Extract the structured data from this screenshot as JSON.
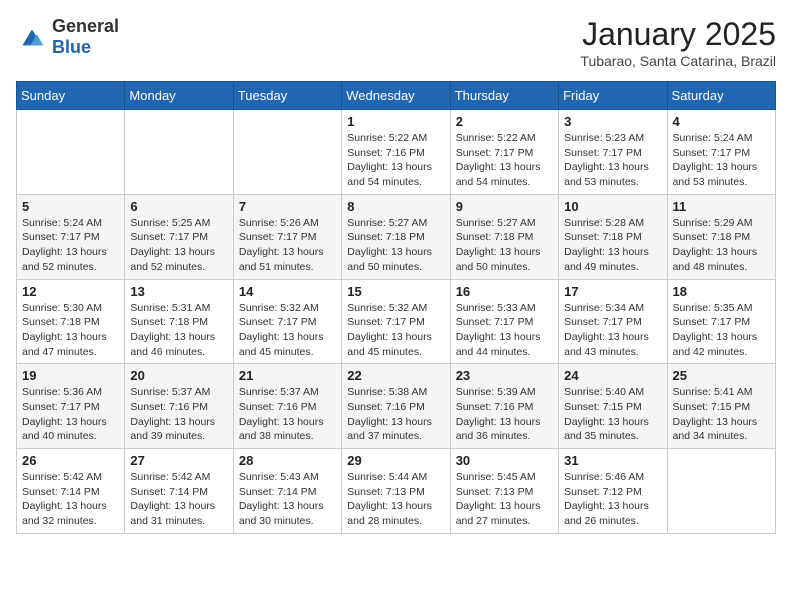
{
  "logo": {
    "general": "General",
    "blue": "Blue"
  },
  "header": {
    "month": "January 2025",
    "location": "Tubarao, Santa Catarina, Brazil"
  },
  "weekdays": [
    "Sunday",
    "Monday",
    "Tuesday",
    "Wednesday",
    "Thursday",
    "Friday",
    "Saturday"
  ],
  "weeks": [
    [
      {
        "day": "",
        "info": ""
      },
      {
        "day": "",
        "info": ""
      },
      {
        "day": "",
        "info": ""
      },
      {
        "day": "1",
        "info": "Sunrise: 5:22 AM\nSunset: 7:16 PM\nDaylight: 13 hours\nand 54 minutes."
      },
      {
        "day": "2",
        "info": "Sunrise: 5:22 AM\nSunset: 7:17 PM\nDaylight: 13 hours\nand 54 minutes."
      },
      {
        "day": "3",
        "info": "Sunrise: 5:23 AM\nSunset: 7:17 PM\nDaylight: 13 hours\nand 53 minutes."
      },
      {
        "day": "4",
        "info": "Sunrise: 5:24 AM\nSunset: 7:17 PM\nDaylight: 13 hours\nand 53 minutes."
      }
    ],
    [
      {
        "day": "5",
        "info": "Sunrise: 5:24 AM\nSunset: 7:17 PM\nDaylight: 13 hours\nand 52 minutes."
      },
      {
        "day": "6",
        "info": "Sunrise: 5:25 AM\nSunset: 7:17 PM\nDaylight: 13 hours\nand 52 minutes."
      },
      {
        "day": "7",
        "info": "Sunrise: 5:26 AM\nSunset: 7:17 PM\nDaylight: 13 hours\nand 51 minutes."
      },
      {
        "day": "8",
        "info": "Sunrise: 5:27 AM\nSunset: 7:18 PM\nDaylight: 13 hours\nand 50 minutes."
      },
      {
        "day": "9",
        "info": "Sunrise: 5:27 AM\nSunset: 7:18 PM\nDaylight: 13 hours\nand 50 minutes."
      },
      {
        "day": "10",
        "info": "Sunrise: 5:28 AM\nSunset: 7:18 PM\nDaylight: 13 hours\nand 49 minutes."
      },
      {
        "day": "11",
        "info": "Sunrise: 5:29 AM\nSunset: 7:18 PM\nDaylight: 13 hours\nand 48 minutes."
      }
    ],
    [
      {
        "day": "12",
        "info": "Sunrise: 5:30 AM\nSunset: 7:18 PM\nDaylight: 13 hours\nand 47 minutes."
      },
      {
        "day": "13",
        "info": "Sunrise: 5:31 AM\nSunset: 7:18 PM\nDaylight: 13 hours\nand 46 minutes."
      },
      {
        "day": "14",
        "info": "Sunrise: 5:32 AM\nSunset: 7:17 PM\nDaylight: 13 hours\nand 45 minutes."
      },
      {
        "day": "15",
        "info": "Sunrise: 5:32 AM\nSunset: 7:17 PM\nDaylight: 13 hours\nand 45 minutes."
      },
      {
        "day": "16",
        "info": "Sunrise: 5:33 AM\nSunset: 7:17 PM\nDaylight: 13 hours\nand 44 minutes."
      },
      {
        "day": "17",
        "info": "Sunrise: 5:34 AM\nSunset: 7:17 PM\nDaylight: 13 hours\nand 43 minutes."
      },
      {
        "day": "18",
        "info": "Sunrise: 5:35 AM\nSunset: 7:17 PM\nDaylight: 13 hours\nand 42 minutes."
      }
    ],
    [
      {
        "day": "19",
        "info": "Sunrise: 5:36 AM\nSunset: 7:17 PM\nDaylight: 13 hours\nand 40 minutes."
      },
      {
        "day": "20",
        "info": "Sunrise: 5:37 AM\nSunset: 7:16 PM\nDaylight: 13 hours\nand 39 minutes."
      },
      {
        "day": "21",
        "info": "Sunrise: 5:37 AM\nSunset: 7:16 PM\nDaylight: 13 hours\nand 38 minutes."
      },
      {
        "day": "22",
        "info": "Sunrise: 5:38 AM\nSunset: 7:16 PM\nDaylight: 13 hours\nand 37 minutes."
      },
      {
        "day": "23",
        "info": "Sunrise: 5:39 AM\nSunset: 7:16 PM\nDaylight: 13 hours\nand 36 minutes."
      },
      {
        "day": "24",
        "info": "Sunrise: 5:40 AM\nSunset: 7:15 PM\nDaylight: 13 hours\nand 35 minutes."
      },
      {
        "day": "25",
        "info": "Sunrise: 5:41 AM\nSunset: 7:15 PM\nDaylight: 13 hours\nand 34 minutes."
      }
    ],
    [
      {
        "day": "26",
        "info": "Sunrise: 5:42 AM\nSunset: 7:14 PM\nDaylight: 13 hours\nand 32 minutes."
      },
      {
        "day": "27",
        "info": "Sunrise: 5:42 AM\nSunset: 7:14 PM\nDaylight: 13 hours\nand 31 minutes."
      },
      {
        "day": "28",
        "info": "Sunrise: 5:43 AM\nSunset: 7:14 PM\nDaylight: 13 hours\nand 30 minutes."
      },
      {
        "day": "29",
        "info": "Sunrise: 5:44 AM\nSunset: 7:13 PM\nDaylight: 13 hours\nand 28 minutes."
      },
      {
        "day": "30",
        "info": "Sunrise: 5:45 AM\nSunset: 7:13 PM\nDaylight: 13 hours\nand 27 minutes."
      },
      {
        "day": "31",
        "info": "Sunrise: 5:46 AM\nSunset: 7:12 PM\nDaylight: 13 hours\nand 26 minutes."
      },
      {
        "day": "",
        "info": ""
      }
    ]
  ]
}
